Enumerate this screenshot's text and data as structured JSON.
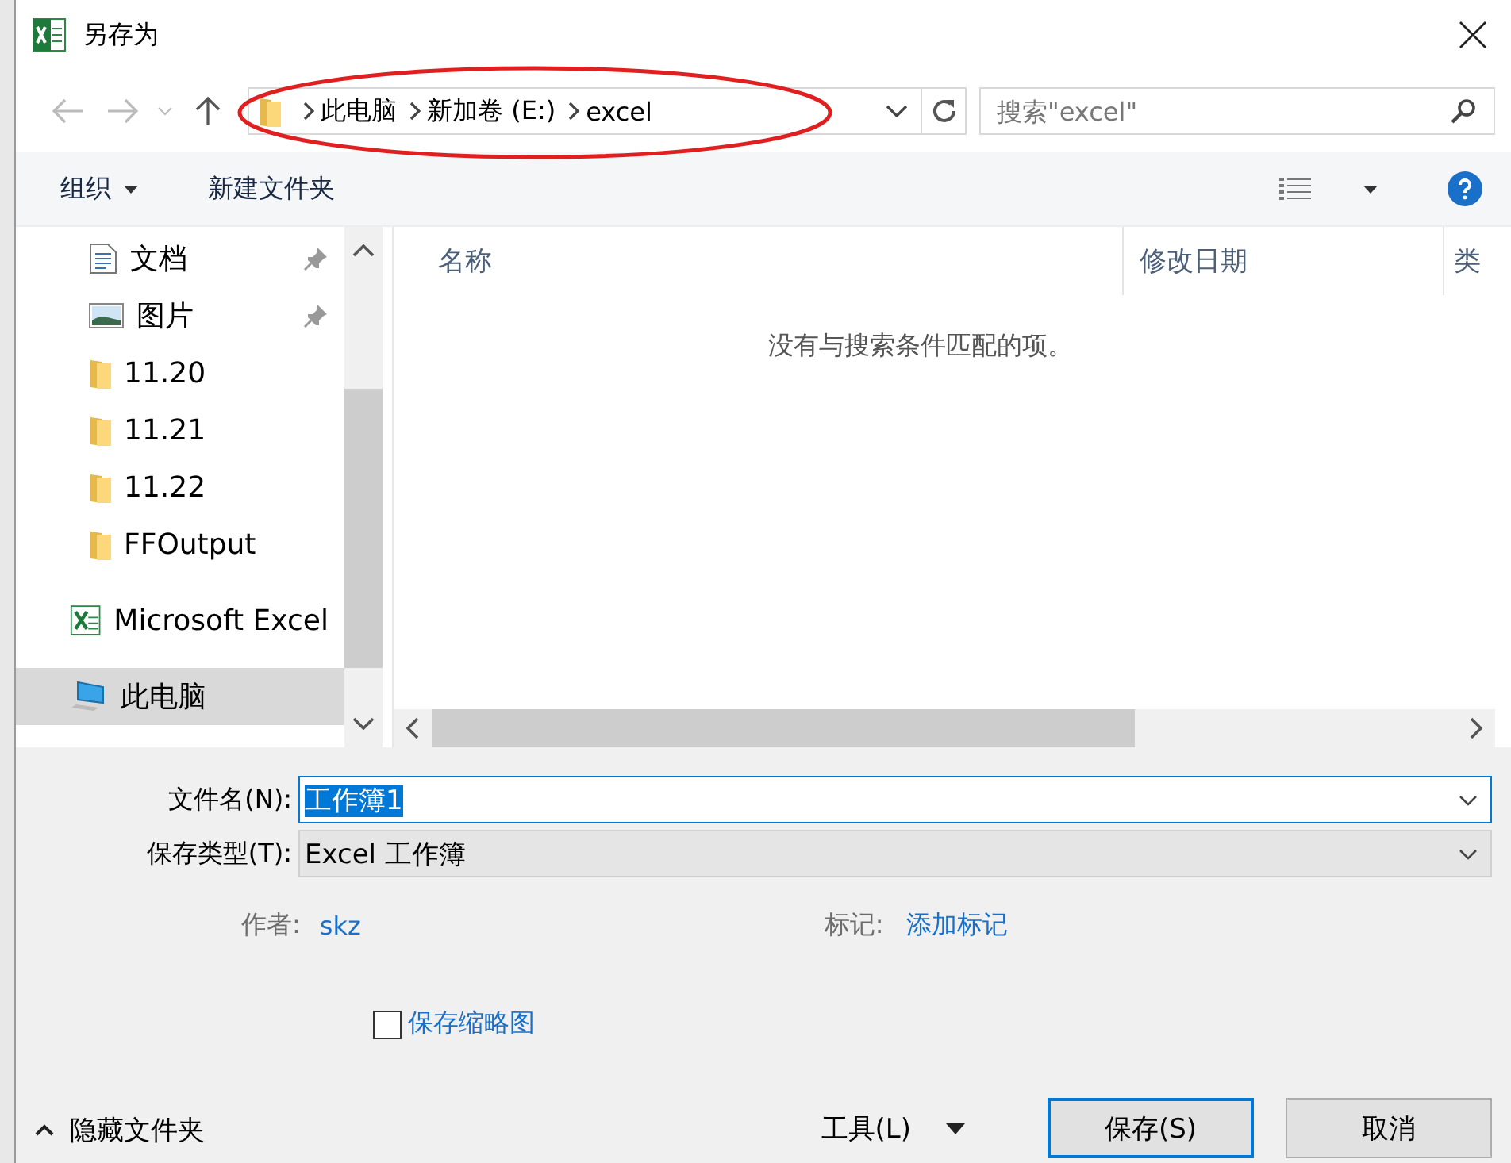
{
  "window": {
    "title": "另存为"
  },
  "address": {
    "path": [
      {
        "label": "此电脑"
      },
      {
        "label": "新加卷 (E:)"
      },
      {
        "label": "excel"
      }
    ],
    "search_placeholder": "搜索\"excel\""
  },
  "toolbar": {
    "organize": "组织",
    "new_folder": "新建文件夹"
  },
  "nav": [
    {
      "label": "文档",
      "kind": "docs",
      "pinned": true,
      "selected": false
    },
    {
      "label": "图片",
      "kind": "pictures",
      "pinned": true,
      "selected": false
    },
    {
      "label": "11.20",
      "kind": "folder",
      "pinned": false,
      "selected": false
    },
    {
      "label": "11.21",
      "kind": "folder",
      "pinned": false,
      "selected": false
    },
    {
      "label": "11.22",
      "kind": "folder",
      "pinned": false,
      "selected": false
    },
    {
      "label": "FFOutput",
      "kind": "folder",
      "pinned": false,
      "selected": false
    },
    {
      "label": "Microsoft Excel",
      "kind": "excel",
      "pinned": false,
      "selected": false
    },
    {
      "label": "此电脑",
      "kind": "computer",
      "pinned": false,
      "selected": true
    }
  ],
  "columns": [
    "名称",
    "修改日期",
    "类"
  ],
  "empty_message": "没有与搜索条件匹配的项。",
  "form": {
    "filename_label": "文件名(N):",
    "filename": "工作簿1",
    "type_label": "保存类型(T):",
    "type": "Excel 工作簿",
    "author_label": "作者:",
    "author": "skz",
    "tags_label": "标记:",
    "tags": "添加标记",
    "thumbnail": {
      "label": "保存缩略图",
      "checked": false
    }
  },
  "footer": {
    "hide_folders": "隐藏文件夹",
    "tools": "工具(L)",
    "save": "保存(S)",
    "cancel": "取消"
  }
}
